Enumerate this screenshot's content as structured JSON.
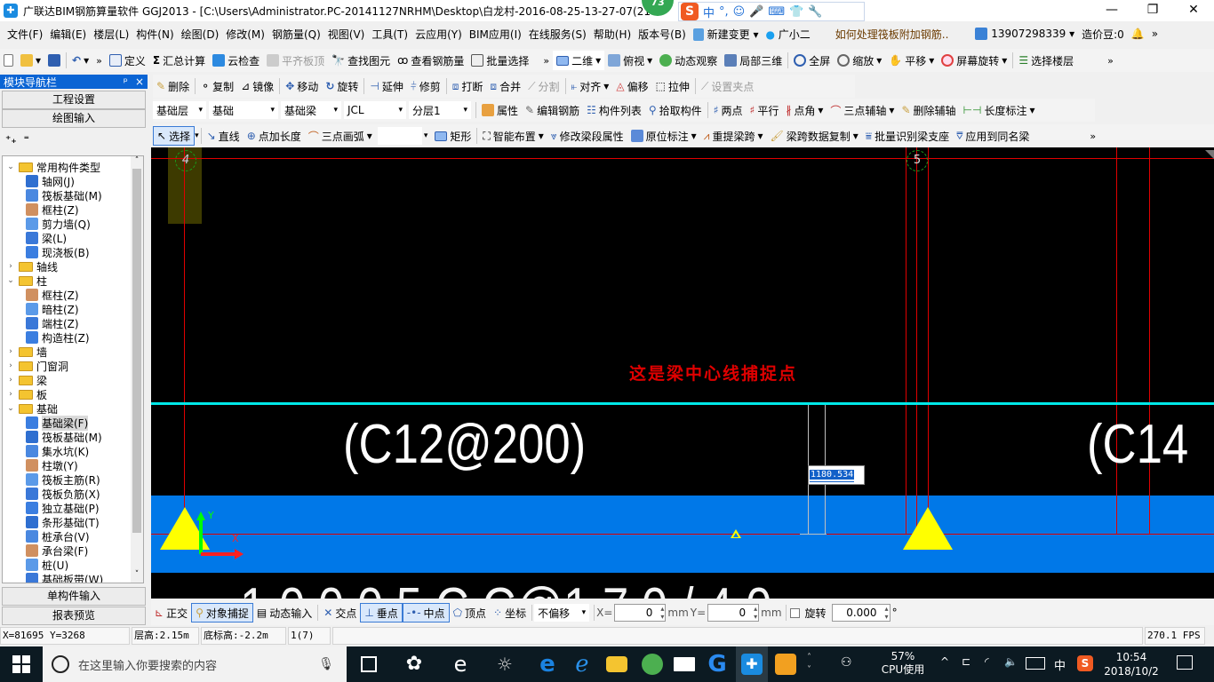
{
  "window": {
    "title": "广联达BIM钢筋算量软件 GGJ2013 - [C:\\Users\\Administrator.PC-20141127NRHM\\Desktop\\白龙村-2016-08-25-13-27-07(216",
    "app_icon": "glodon-app-icon",
    "notification_badge": "73",
    "controls": {
      "minimize": "—",
      "maximize": "❐",
      "close": "✕"
    }
  },
  "ime_bar": {
    "logo": "S",
    "items": [
      "中",
      "°,",
      "☺",
      "🎤",
      "⌨",
      "👕",
      "🔧"
    ]
  },
  "menubar": {
    "items": [
      "文件(F)",
      "编辑(E)",
      "楼层(L)",
      "构件(N)",
      "绘图(D)",
      "修改(M)",
      "钢筋量(Q)",
      "视图(V)",
      "工具(T)",
      "云应用(Y)",
      "BIM应用(I)",
      "在线服务(S)",
      "帮助(H)",
      "版本号(B)"
    ],
    "new_change": "新建变更",
    "assistant": "广小二",
    "help_link": "如何处理筏板附加钢筋..",
    "account": "13907298339",
    "beans": "造价豆:0"
  },
  "toolbar1": {
    "left": [
      "定义",
      "汇总计算",
      "云检查",
      "平齐板顶",
      "查找图元",
      "查看钢筋量",
      "批量选择"
    ],
    "right": [
      "二维",
      "俯视",
      "动态观察",
      "局部三维",
      "全屏",
      "缩放",
      "平移",
      "屏幕旋转",
      "选择楼层"
    ]
  },
  "toolbar2": {
    "items": [
      "删除",
      "复制",
      "镜像",
      "移动",
      "旋转",
      "延伸",
      "修剪",
      "打断",
      "合并",
      "分割",
      "对齐",
      "偏移",
      "拉伸",
      "设置夹点"
    ]
  },
  "toolbar3": {
    "combos": [
      "基础层",
      "基础",
      "基础梁",
      "JCL",
      "分层1"
    ],
    "items": [
      "属性",
      "编辑钢筋",
      "构件列表",
      "拾取构件",
      "两点",
      "平行",
      "点角",
      "三点辅轴",
      "删除辅轴",
      "长度标注"
    ]
  },
  "toolbar4": {
    "items": [
      "选择",
      "直线",
      "点加长度",
      "三点画弧",
      "矩形",
      "智能布置",
      "修改梁段属性",
      "原位标注",
      "重提梁跨",
      "梁跨数据复制",
      "批量识别梁支座",
      "应用到同名梁"
    ]
  },
  "nav": {
    "title": "模块导航栏",
    "pin": "ᵖ",
    "close": "×",
    "buttons_top": [
      "工程设置",
      "绘图输入"
    ],
    "buttons_bottom": [
      "单构件输入",
      "报表预览"
    ],
    "tree": [
      {
        "label": "常用构件类型",
        "level": 0,
        "type": "folder",
        "expanded": true
      },
      {
        "label": "轴网(J)",
        "level": 1,
        "type": "item"
      },
      {
        "label": "筏板基础(M)",
        "level": 1,
        "type": "item"
      },
      {
        "label": "框柱(Z)",
        "level": 1,
        "type": "item"
      },
      {
        "label": "剪力墙(Q)",
        "level": 1,
        "type": "item"
      },
      {
        "label": "梁(L)",
        "level": 1,
        "type": "item"
      },
      {
        "label": "现浇板(B)",
        "level": 1,
        "type": "item"
      },
      {
        "label": "轴线",
        "level": 0,
        "type": "folder",
        "expanded": false
      },
      {
        "label": "柱",
        "level": 0,
        "type": "folder",
        "expanded": true
      },
      {
        "label": "框柱(Z)",
        "level": 1,
        "type": "item"
      },
      {
        "label": "暗柱(Z)",
        "level": 1,
        "type": "item"
      },
      {
        "label": "端柱(Z)",
        "level": 1,
        "type": "item"
      },
      {
        "label": "构造柱(Z)",
        "level": 1,
        "type": "item"
      },
      {
        "label": "墙",
        "level": 0,
        "type": "folder",
        "expanded": false
      },
      {
        "label": "门窗洞",
        "level": 0,
        "type": "folder",
        "expanded": false
      },
      {
        "label": "梁",
        "level": 0,
        "type": "folder",
        "expanded": false
      },
      {
        "label": "板",
        "level": 0,
        "type": "folder",
        "expanded": false
      },
      {
        "label": "基础",
        "level": 0,
        "type": "folder",
        "expanded": true
      },
      {
        "label": "基础梁(F)",
        "level": 1,
        "type": "item",
        "selected": true
      },
      {
        "label": "筏板基础(M)",
        "level": 1,
        "type": "item"
      },
      {
        "label": "集水坑(K)",
        "level": 1,
        "type": "item"
      },
      {
        "label": "柱墩(Y)",
        "level": 1,
        "type": "item"
      },
      {
        "label": "筏板主筋(R)",
        "level": 1,
        "type": "item"
      },
      {
        "label": "筏板负筋(X)",
        "level": 1,
        "type": "item"
      },
      {
        "label": "独立基础(P)",
        "level": 1,
        "type": "item"
      },
      {
        "label": "条形基础(T)",
        "level": 1,
        "type": "item"
      },
      {
        "label": "桩承台(V)",
        "level": 1,
        "type": "item"
      },
      {
        "label": "承台梁(F)",
        "level": 1,
        "type": "item"
      },
      {
        "label": "桩(U)",
        "level": 1,
        "type": "item"
      },
      {
        "label": "基础板带(W)",
        "level": 1,
        "type": "item"
      }
    ]
  },
  "canvas": {
    "axis_labels": [
      "4",
      "5"
    ],
    "annotation": "这是梁中心线捕捉点",
    "rebar_text_1": "(C12@200)",
    "rebar_text_2": "(C14",
    "dim_input": "1180.534",
    "ucs_x": "X",
    "ucs_y": "Y",
    "colors": {
      "background": "#000000",
      "axis": "#e00000",
      "beam": "#0078e8",
      "centerline": "#00e8e8",
      "support": "#ffff00",
      "annotation": "#e00000"
    }
  },
  "snapbar": {
    "items": [
      "正交",
      "对象捕捉",
      "动态输入",
      "交点",
      "垂点",
      "中点",
      "顶点",
      "坐标"
    ],
    "active": [
      "对象捕捉",
      "垂点",
      "中点"
    ],
    "offset_mode": "不偏移",
    "x_label": "X=",
    "x_value": "0",
    "y_label": "Y=",
    "y_value": "0",
    "unit": "mm",
    "rotate_label": "旋转",
    "rotate_value": "0.000",
    "degree": "°"
  },
  "statusbar": {
    "coords": "X=81695 Y=3268",
    "floor_height": "层高:2.15m",
    "bottom_elev": "底标高:-2.2m",
    "count": "1(7)",
    "fps": "270.1 FPS"
  },
  "taskbar": {
    "search_placeholder": "在这里输入你要搜索的内容",
    "cpu_percent": "57%",
    "cpu_label": "CPU使用",
    "ime": "中",
    "time": "10:54",
    "date": "2018/10/2"
  }
}
